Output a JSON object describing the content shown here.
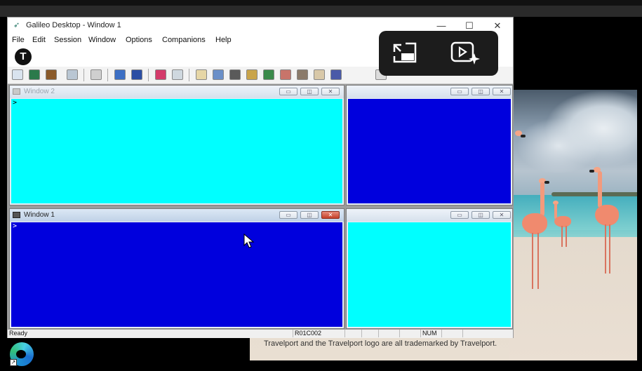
{
  "app": {
    "title": "Galileo Desktop - Window 1",
    "controls": {
      "minimize": "—",
      "maximize": "☐",
      "close": "✕"
    }
  },
  "menu": [
    "File",
    "Edit",
    "Session",
    "Window",
    "Options",
    "Companions",
    "Help"
  ],
  "ribbon": {
    "logo_letter": "T"
  },
  "windows": {
    "window2": {
      "title": "Window 2",
      "prompt": ">",
      "body_color": "#00ffff"
    },
    "window_tr": {
      "title": "",
      "body_color": "#0000dd"
    },
    "window1": {
      "title": "Window 1",
      "prompt": ">",
      "body_color": "#0000dd"
    },
    "window_br": {
      "title": "",
      "body_color": "#00ffff"
    }
  },
  "status": {
    "text": "Ready",
    "cell": "R01C002",
    "num": "NUM"
  },
  "background": {
    "caption": "Travelport and the Travelport logo are all trademarked by Travelport."
  },
  "colors": {
    "cyan": "#00ffff",
    "blue": "#0000dd"
  }
}
